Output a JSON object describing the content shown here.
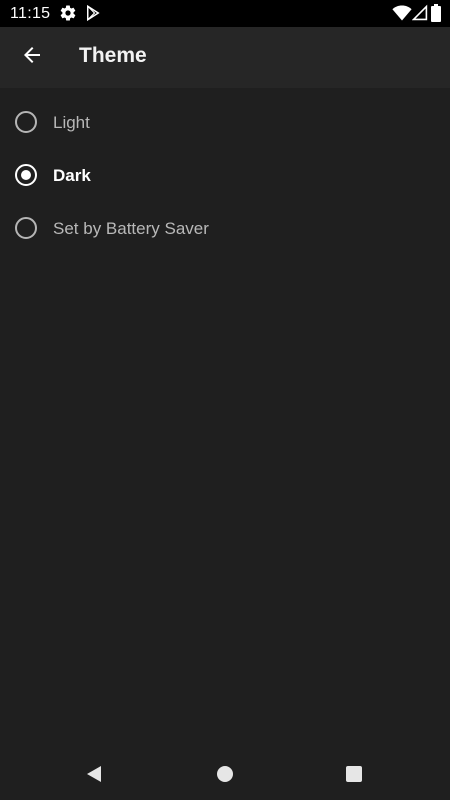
{
  "status_bar": {
    "time": "11:15",
    "icons": [
      "gear-icon",
      "play-store-icon",
      "wifi-icon",
      "cell-signal-icon",
      "battery-icon"
    ]
  },
  "app_bar": {
    "title": "Theme",
    "back_icon": "arrow-back-icon"
  },
  "options": [
    {
      "label": "Light",
      "selected": false
    },
    {
      "label": "Dark",
      "selected": true
    },
    {
      "label": "Set by Battery Saver",
      "selected": false
    }
  ],
  "nav_bar": {
    "buttons": [
      "back-triangle-icon",
      "home-circle-icon",
      "recents-square-icon"
    ]
  },
  "colors": {
    "background": "#1f1f1f",
    "app_bar": "#262626",
    "status_bar": "#000000",
    "selected_text": "#ffffff",
    "unselected_text": "#b8b8b8"
  }
}
